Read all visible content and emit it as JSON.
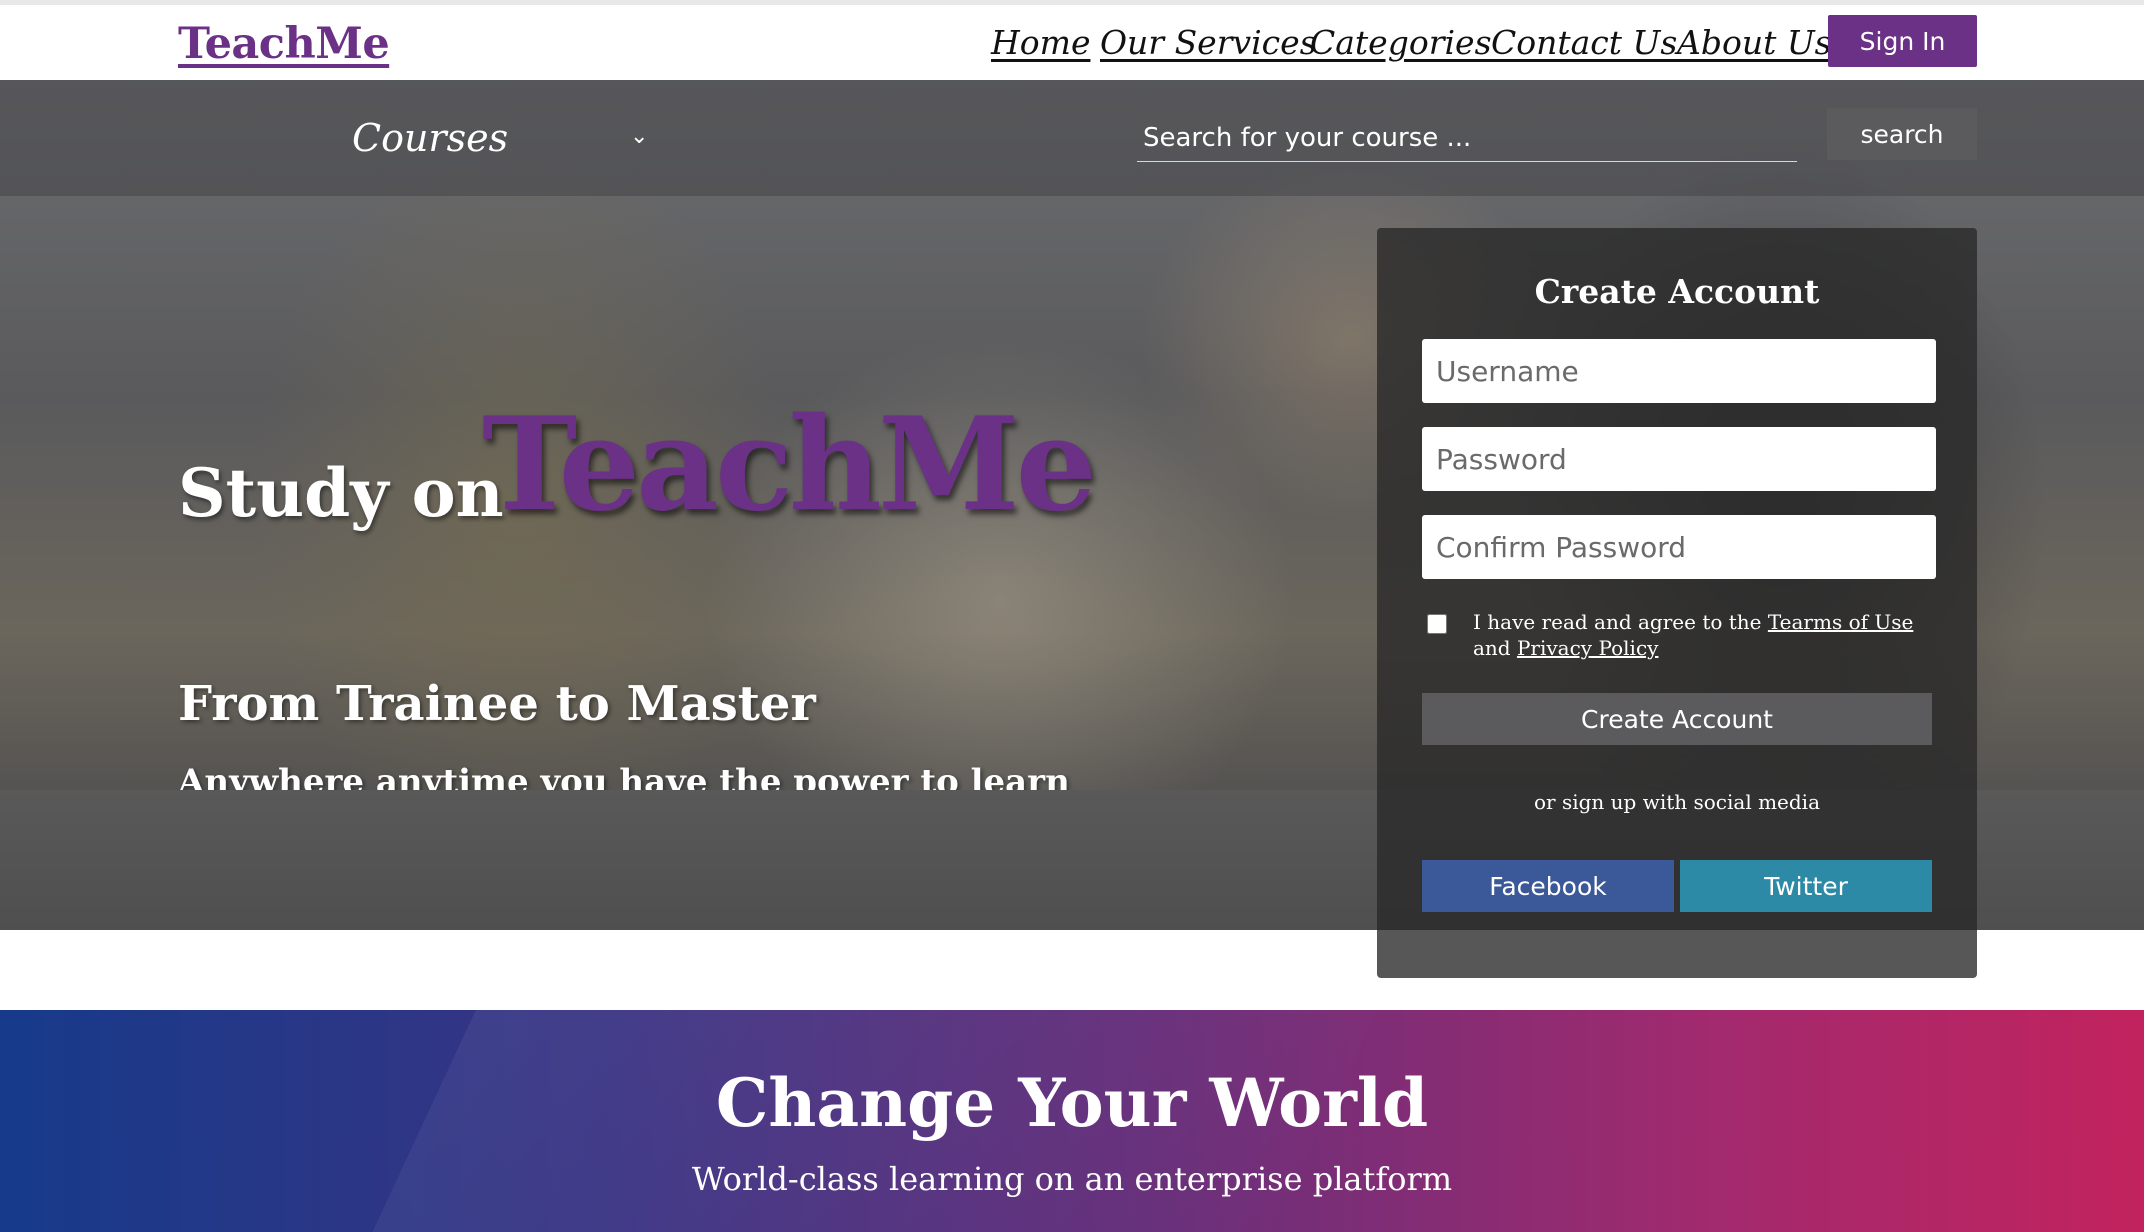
{
  "header": {
    "logo": "TeachMe",
    "nav": [
      "Home",
      "Our Services",
      "Categories",
      "Contact Us",
      "About Us"
    ],
    "signin_label": "Sign In"
  },
  "search": {
    "courses_label": "Courses",
    "placeholder": "Search for your course ...",
    "button_label": "search"
  },
  "hero": {
    "study_on": "Study on",
    "brand": "TeachMe",
    "headline": "From Trainee to Master",
    "subline": "Anywhere anytime you have the power to learn"
  },
  "signup": {
    "title": "Create Account",
    "username_placeholder": "Username",
    "password_placeholder": "Password",
    "confirm_placeholder": "Confirm Password",
    "agree_prefix": "I have read and agree to the",
    "terms_link": "Tearms of Use",
    "agree_and": "and",
    "privacy_link": "Privacy Policy",
    "create_label": "Create Account",
    "social_text": "or sign up with social media",
    "facebook_label": "Facebook",
    "twitter_label": "Twitter"
  },
  "banner": {
    "title": "Change Your World",
    "subtitle": "World-class learning on an enterprise platform"
  },
  "colors": {
    "brand": "#6a3187",
    "facebook": "#3b5998",
    "twitter": "#2c8aa6",
    "button_gray": "#5b5b5d"
  }
}
